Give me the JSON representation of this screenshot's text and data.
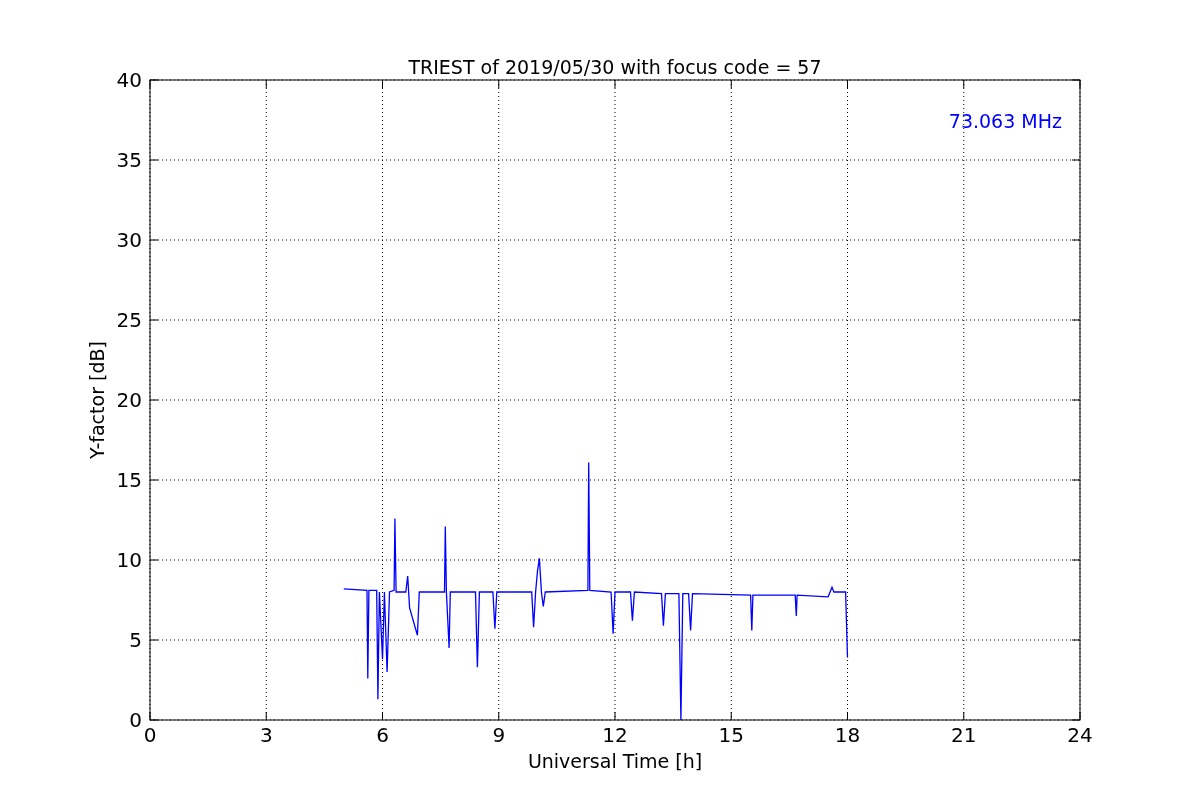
{
  "figure": {
    "chart_data": {
      "type": "line",
      "title": "TRIEST of 2019/05/30 with focus code = 57",
      "xlabel": "Universal Time [h]",
      "ylabel": "Y-factor [dB]",
      "xlim": [
        0,
        24
      ],
      "ylim": [
        0,
        40
      ],
      "xticks": [
        0,
        3,
        6,
        9,
        12,
        15,
        18,
        21,
        24
      ],
      "yticks": [
        0,
        5,
        10,
        15,
        20,
        25,
        30,
        35,
        40
      ],
      "grid": true,
      "annotations": [
        "73.063 MHz"
      ],
      "x": [
        5.0,
        5.6,
        5.62,
        5.65,
        5.85,
        5.88,
        5.92,
        6.0,
        6.05,
        6.12,
        6.18,
        6.3,
        6.32,
        6.35,
        6.6,
        6.65,
        6.7,
        6.9,
        6.95,
        7.6,
        7.62,
        7.65,
        7.72,
        7.75,
        8.4,
        8.45,
        8.5,
        8.85,
        8.9,
        8.95,
        9.85,
        9.9,
        9.95,
        10.0,
        10.05,
        10.1,
        10.15,
        10.2,
        11.3,
        11.32,
        11.35,
        11.9,
        11.95,
        12.0,
        12.4,
        12.45,
        12.5,
        13.2,
        13.25,
        13.3,
        13.65,
        13.7,
        13.75,
        13.9,
        13.95,
        14.0,
        15.5,
        15.53,
        15.56,
        16.65,
        16.68,
        16.7,
        17.5,
        17.6,
        17.65,
        17.95,
        18.0
      ],
      "series": [
        {
          "color": "#0000ff",
          "values": [
            8.2,
            8.1,
            2.6,
            8.1,
            8.1,
            1.3,
            8.0,
            3.8,
            8.0,
            3.0,
            8.0,
            8.1,
            12.6,
            8.0,
            8.0,
            9.0,
            7.0,
            5.3,
            8.0,
            8.0,
            12.1,
            8.0,
            4.5,
            8.0,
            8.0,
            3.3,
            8.0,
            8.0,
            5.7,
            8.0,
            8.0,
            5.8,
            8.0,
            9.3,
            10.1,
            8.0,
            7.1,
            8.0,
            8.1,
            16.1,
            8.1,
            8.0,
            5.4,
            8.0,
            8.0,
            6.2,
            8.0,
            7.9,
            5.9,
            7.9,
            7.9,
            0,
            7.9,
            7.9,
            5.6,
            7.9,
            7.8,
            5.6,
            7.8,
            7.8,
            6.5,
            7.8,
            7.7,
            8.3,
            8.0,
            8.0,
            3.9
          ]
        }
      ]
    }
  }
}
